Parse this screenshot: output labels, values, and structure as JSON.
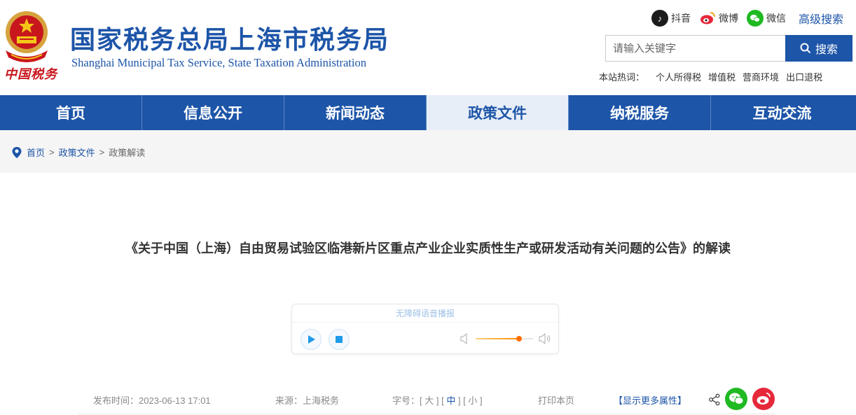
{
  "header": {
    "title": "国家税务总局上海市税务局",
    "subtitle": "Shanghai Municipal Tax Service, State Taxation Administration",
    "emblem_text": "中国税务",
    "brand_color": "#1d55a8"
  },
  "social": {
    "douyin": "抖音",
    "weibo": "微博",
    "wechat": "微信",
    "advanced_search": "高级搜索"
  },
  "search": {
    "placeholder": "请输入关键字",
    "button": "搜索"
  },
  "hot_words": {
    "label": "本站热词：",
    "items": [
      "个人所得税",
      "增值税",
      "营商环境",
      "出口退税"
    ]
  },
  "nav": {
    "items": [
      {
        "label": "首页"
      },
      {
        "label": "信息公开"
      },
      {
        "label": "新闻动态"
      },
      {
        "label": "政策文件",
        "active": true
      },
      {
        "label": "纳税服务"
      },
      {
        "label": "互动交流"
      }
    ]
  },
  "breadcrumb": {
    "home": "首页",
    "sep1": ">",
    "level1": "政策文件",
    "sep2": ">",
    "current": "政策解读"
  },
  "article": {
    "title": "《关于中国（上海）自由贸易试验区临港新片区重点产业企业实质性生产或研发活动有关问题的公告》的解读"
  },
  "player": {
    "label": "无障碍语音播报",
    "volume": 0.75
  },
  "meta": {
    "publish_label": "发布时间：",
    "publish_time": "2023-06-13 17:01",
    "source_label": "来源：",
    "source": "上海税务",
    "fontsize_label": "字号：",
    "size_large": "大",
    "size_medium": "中",
    "size_small": "小",
    "print": "打印本页",
    "more_attrs": "【显示更多属性】"
  }
}
